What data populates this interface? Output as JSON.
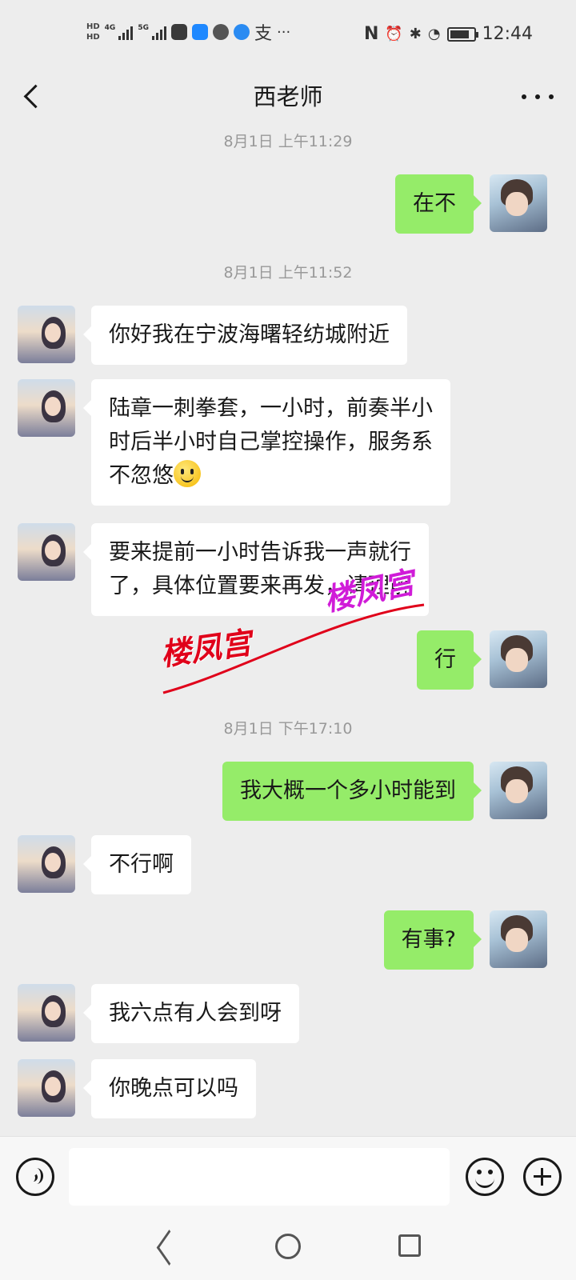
{
  "status_bar": {
    "hd1": "HD",
    "hd2": "HD",
    "net1": "4G",
    "net2": "5G",
    "time": "12:44",
    "app_icons": [
      "huawei-icon",
      "lightbulb-icon",
      "chat-bubble-icon",
      "browser-icon",
      "alipay-icon"
    ],
    "more_notifications": "···",
    "nfc": "N",
    "alarm": "⏰",
    "bluetooth": "✱"
  },
  "header": {
    "title": "西老师"
  },
  "chat": {
    "timestamps": [
      "8月1日 上午11:29",
      "8月1日 上午11:52",
      "8月1日 下午17:10"
    ],
    "messages": [
      {
        "side": "right",
        "text": "在不"
      },
      {
        "side": "left",
        "text": "你好我在宁波海曙轻纺城附近"
      },
      {
        "side": "left",
        "line1": "陆章一刺拳套，一小时，前奏半小",
        "line2": "时后半小时自己掌控操作，服务系",
        "line3": "不忽悠"
      },
      {
        "side": "left",
        "line1": "要来提前一小时告诉我一声就行",
        "line2": "了，具体位置要来再发，请理解"
      },
      {
        "side": "right",
        "text": "行"
      },
      {
        "side": "right",
        "text": "我大概一个多小时能到"
      },
      {
        "side": "left",
        "text": "不行啊"
      },
      {
        "side": "right",
        "text": "有事?"
      },
      {
        "side": "left",
        "text": "我六点有人会到呀"
      },
      {
        "side": "left",
        "text": "你晚点可以吗"
      }
    ]
  },
  "watermark": {
    "text_red": "楼凤宫",
    "text_purple": "楼凤宫",
    "color_red": "#e0001a",
    "color_purple": "#d01cd8"
  },
  "input_bar": {
    "placeholder": ""
  },
  "colors": {
    "sent_bubble": "#95ec69",
    "received_bubble": "#ffffff",
    "background": "#ededed"
  }
}
